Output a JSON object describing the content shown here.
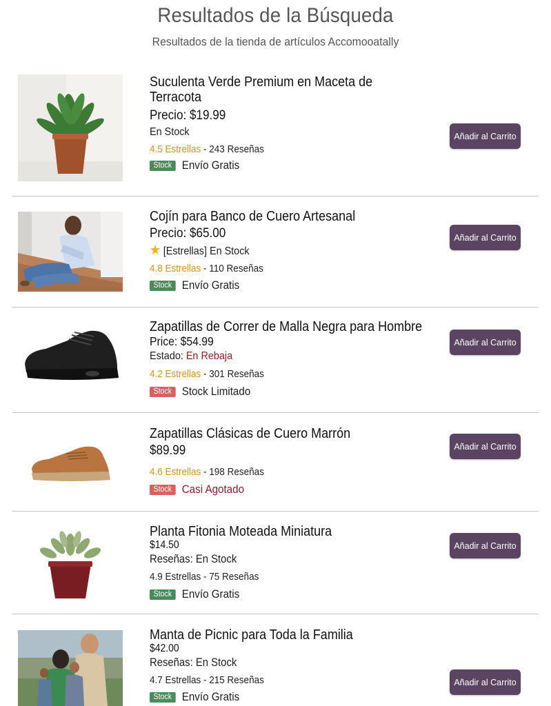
{
  "header": {
    "title": "Resultados de la Búsqueda",
    "subtitle": "Resultados de la tienda de artículos Accomooatally"
  },
  "cart_label": "Añadir al Carrito",
  "colors": {
    "button": "#5b4461",
    "badge_green": "#4a8b5b",
    "badge_red": "#d9615f",
    "rating_gold": "#c89a24",
    "sale_red": "#8b1f2c"
  },
  "products": [
    {
      "title_1": "Suculenta Verde Premium en Maceta de",
      "title_2": "Terracota",
      "price": "Precio: $19.99",
      "status": "En Stock",
      "rating": "4.5 Estrellas",
      "reviews": " - 243 Reseñas",
      "badge": "Stock",
      "shipping": "Envío Gratis",
      "image": "succulent-plant-image"
    },
    {
      "title_1": "Cojín para Banco de Cuero Artesanal",
      "price": "Precio: $65.00",
      "status": "[Estrellas] En Stock",
      "rating": "4.8 Estrellas",
      "reviews": " - 110 Reseñas",
      "badge": "Stock",
      "shipping": "Envío Gratis",
      "image": "man-sitting-image"
    },
    {
      "title_1": "Zapatillas de Correr de Malla Negra para Hombre",
      "price": "Price: $54.99",
      "status_label": "Estado: ",
      "status_value": "En Rebaja",
      "rating": "4.2 Estrellas",
      "reviews": " - 301 Reseñas",
      "badge": "Stock",
      "shipping": "Stock Limitado",
      "image": "black-running-shoe-image"
    },
    {
      "title_1": "Zapatillas Clásicas de Cuero Marrón",
      "price": "$89.99",
      "rating": "4.6 Estrellas",
      "reviews": " - 198 Reseñas",
      "badge": "Stock",
      "shipping": "Casi Agotado",
      "image": "brown-leather-sneaker-image"
    },
    {
      "title_1": "Planta Fitonia Moteada Miniatura",
      "price": "$14.50",
      "status": "Reseñas: En Stock",
      "rating": "4.9 Estrellas - 75 Reseñas",
      "badge": "Stock",
      "shipping": "Envío Gratis",
      "image": "fittonia-plant-image"
    },
    {
      "title_1": "Manta de Picnic para Toda la Familia",
      "price": "$42.00",
      "status": "Reseñas: En Stock",
      "rating": "4.7 Estrellas - 215 Reseñas",
      "badge": "Stock",
      "shipping": "Envío Gratis",
      "image": "family-photo-image"
    }
  ]
}
